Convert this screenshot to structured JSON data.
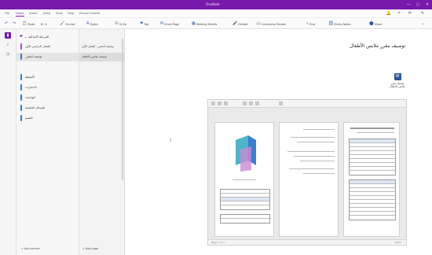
{
  "window": {
    "title": "OneNote",
    "user": "",
    "controls": [
      "—",
      "▢",
      "✕"
    ]
  },
  "menu": {
    "tabs": [
      "File",
      "Home",
      "Insert",
      "Draw",
      "View",
      "Help",
      "Picture Format"
    ],
    "active_index": 1
  },
  "ribbon": {
    "items": [
      {
        "label": "Paste",
        "icon": "paste-icon"
      },
      {
        "label": "B I U",
        "icon": "format-icon"
      },
      {
        "label": "Format",
        "icon": "format-painter-icon"
      },
      {
        "label": "Styles",
        "icon": "styles-icon"
      },
      {
        "label": "To Do",
        "icon": "checkbox-icon"
      },
      {
        "label": "Tag",
        "icon": "tag-icon"
      },
      {
        "label": "Email Page",
        "icon": "email-icon"
      },
      {
        "label": "Meeting Details",
        "icon": "calendar-icon"
      },
      {
        "label": "Dictate",
        "icon": "mic-icon"
      },
      {
        "label": "Immersive Reader",
        "icon": "reader-icon"
      },
      {
        "label": "Find",
        "icon": "search-icon"
      },
      {
        "label": "Sticky Notes",
        "icon": "note-icon"
      },
      {
        "label": "Share",
        "icon": "share-icon"
      }
    ]
  },
  "sections": {
    "notebook": "المرحلة الابتدائية",
    "items": [
      {
        "label": "الفصل الدراسي الأول",
        "color": "#b04bd1"
      },
      {
        "label": "توصيف المقرر",
        "color": "#2b7cd3"
      },
      {
        "label": "الأنشطة",
        "color": "#2b7cd3"
      },
      {
        "label": "الاختبارات",
        "color": "#2b7cd3"
      },
      {
        "label": "الواجبات",
        "color": "#2b7cd3"
      },
      {
        "label": "الوسائل التعليمية",
        "color": "#2b7cd3"
      },
      {
        "label": "التقييم",
        "color": "#2b7cd3"
      }
    ],
    "active_index": 1,
    "add_section": "+ Add section"
  },
  "pages": {
    "items": [
      {
        "label": "توصيف المقرر - الفصل الأول"
      },
      {
        "label": "توصيف ملابس الأطفال"
      }
    ],
    "active_index": 1,
    "add_page": "+ Add page"
  },
  "canvas": {
    "page_title": "توصيف مقرر ملابس الأطفال",
    "attachment_name": "توصيف مقرر ملابس الأطفال",
    "attachment_icon": "word-file-icon"
  },
  "embedded": {
    "status_left": "Page 1 of 3",
    "status_right": "100%"
  },
  "colors": {
    "accent": "#7719aa",
    "word_blue": "#2b579a"
  }
}
